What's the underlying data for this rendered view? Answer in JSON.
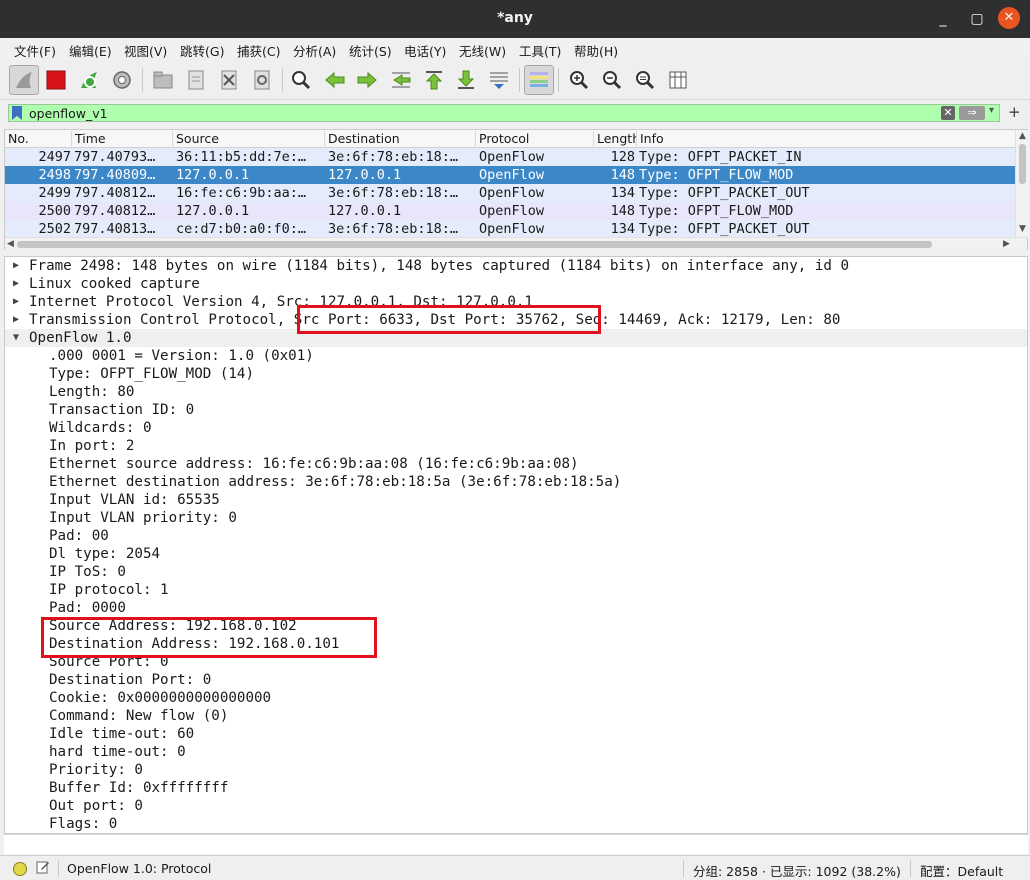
{
  "window": {
    "title": "*any",
    "min": "_",
    "max": "▢",
    "close": "✕"
  },
  "menu": [
    "文件(F)",
    "编辑(E)",
    "视图(V)",
    "跳转(G)",
    "捕获(C)",
    "分析(A)",
    "统计(S)",
    "电话(Y)",
    "无线(W)",
    "工具(T)",
    "帮助(H)"
  ],
  "filter": {
    "value": "openflow_v1",
    "clear": "✕",
    "apply": "⇒",
    "dropdown": "▾",
    "add": "+"
  },
  "packet_list": {
    "columns": [
      "No.",
      "Time",
      "Source",
      "Destination",
      "Protocol",
      "Length",
      "Info"
    ],
    "rows": [
      {
        "no": "2497",
        "time": "797.40793…",
        "src": "36:11:b5:dd:7e:…",
        "dst": "3e:6f:78:eb:18:…",
        "proto": "OpenFlow",
        "len": "128",
        "info": "Type: OFPT_PACKET_IN"
      },
      {
        "no": "2498",
        "time": "797.40809…",
        "src": "127.0.0.1",
        "dst": "127.0.0.1",
        "proto": "OpenFlow",
        "len": "148",
        "info": "Type: OFPT_FLOW_MOD"
      },
      {
        "no": "2499",
        "time": "797.40812…",
        "src": "16:fe:c6:9b:aa:…",
        "dst": "3e:6f:78:eb:18:…",
        "proto": "OpenFlow",
        "len": "134",
        "info": "Type: OFPT_PACKET_OUT"
      },
      {
        "no": "2500",
        "time": "797.40812…",
        "src": "127.0.0.1",
        "dst": "127.0.0.1",
        "proto": "OpenFlow",
        "len": "148",
        "info": "Type: OFPT_FLOW_MOD"
      },
      {
        "no": "2502",
        "time": "797.40813…",
        "src": "ce:d7:b0:a0:f0:…",
        "dst": "3e:6f:78:eb:18:…",
        "proto": "OpenFlow",
        "len": "134",
        "info": "Type: OFPT_PACKET_OUT"
      }
    ]
  },
  "details": {
    "top": [
      "Frame 2498: 148 bytes on wire (1184 bits), 148 bytes captured (1184 bits) on interface any, id 0",
      "Linux cooked capture",
      "Internet Protocol Version 4, Src: 127.0.0.1, Dst: 127.0.0.1",
      "Transmission Control Protocol, Src Port: 6633, Dst Port: 35762, Seq: 14469, Ack: 12179, Len: 80",
      "OpenFlow 1.0"
    ],
    "openflow": [
      ".000 0001 = Version: 1.0 (0x01)",
      "Type: OFPT_FLOW_MOD (14)",
      "Length: 80",
      "Transaction ID: 0",
      "Wildcards: 0",
      "In port: 2",
      "Ethernet source address: 16:fe:c6:9b:aa:08 (16:fe:c6:9b:aa:08)",
      "Ethernet destination address: 3e:6f:78:eb:18:5a (3e:6f:78:eb:18:5a)",
      "Input VLAN id: 65535",
      "Input VLAN priority: 0",
      "Pad: 00",
      "Dl type: 2054",
      "IP ToS: 0",
      "IP protocol: 1",
      "Pad: 0000",
      "Source Address: 192.168.0.102",
      "Destination Address: 192.168.0.101",
      "Source Port: 0",
      "Destination Port: 0",
      "Cookie: 0x0000000000000000",
      "Command: New flow (0)",
      "Idle time-out: 60",
      "hard time-out: 0",
      "Priority: 0",
      "Buffer Id: 0xffffffff",
      "Out port: 0",
      "Flags: 0"
    ]
  },
  "status": {
    "profile_text": "OpenFlow 1.0: Protocol",
    "counts": "分组: 2858 · 已显示: 1092 (38.2%)",
    "profile": "配置：Default"
  },
  "colors": {
    "selected_row": "#3b87c7",
    "filter_ok": "#afffaf",
    "highlight_box": "#e0101d"
  }
}
